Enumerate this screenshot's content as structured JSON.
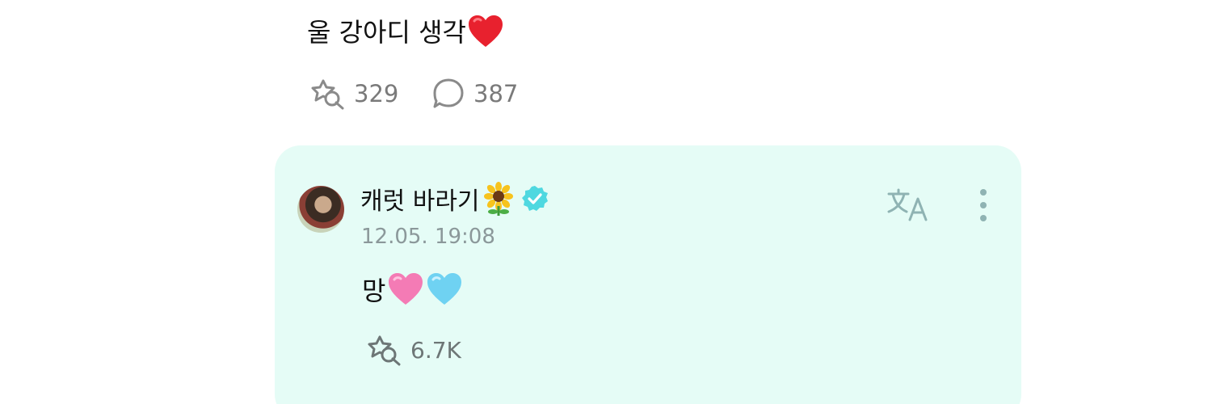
{
  "post": {
    "text": "울 강아디 생각",
    "trailing_emoji": "red-heart",
    "like_count": "329",
    "comment_count": "387"
  },
  "reply": {
    "author_name": "캐럿 바라기",
    "author_emoji": "sunflower",
    "verified": true,
    "timestamp": "12.05. 19:08",
    "text": "망",
    "emojis": [
      "pink-heart",
      "light-blue-heart"
    ],
    "like_count": "6.7K",
    "background": "#e5fcf6"
  },
  "icons": {
    "like": "like-icon",
    "comment": "comment-icon",
    "translate": "translate-icon",
    "more": "more-vertical-icon",
    "verified": "verified-badge-icon"
  },
  "colors": {
    "verified_badge": "#4fd8e0",
    "icon_gray": "#8a8a8a",
    "translate_icon": "#8fb3b3"
  }
}
